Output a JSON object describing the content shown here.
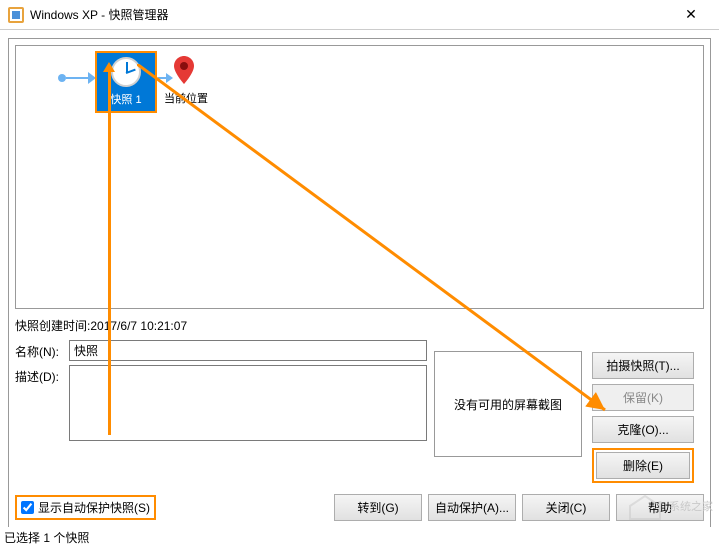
{
  "title": "Windows XP - 快照管理器",
  "timeline": {
    "snapshot_name": "快照 1",
    "current_position": "当前位置"
  },
  "created_label": "快照创建时间",
  "created_time": "2017/6/7 10:21:07",
  "name_label": "名称(N):",
  "name_value": "快照",
  "desc_label": "描述(D):",
  "desc_value": "",
  "preview_text": "没有可用的屏幕截图",
  "buttons": {
    "take": "拍摄快照(T)...",
    "keep": "保留(K)",
    "clone": "克隆(O)...",
    "delete": "删除(E)"
  },
  "checkbox_label": "显示自动保护快照(S)",
  "bottom": {
    "goto": "转到(G)",
    "autoprotect": "自动保护(A)...",
    "close": "关闭(C)",
    "help": "帮助"
  },
  "status": "已选择 1 个快照",
  "watermark": "系统之家"
}
